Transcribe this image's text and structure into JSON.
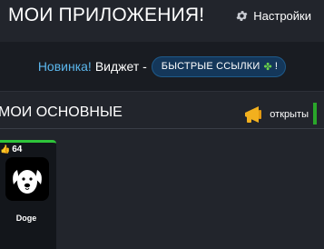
{
  "header": {
    "title": "МОИ ПРИЛОЖЕНИЯ!",
    "settings_label": "Настройки",
    "settings_icon": "gear-icon"
  },
  "promo": {
    "new_label": "Новинка!",
    "widget_label": "Виджет -",
    "pill_label": "БЫСТРЫЕ ССЫЛКИ",
    "pill_icon": "clover-icon",
    "pill_suffix": "!"
  },
  "section": {
    "title": "МОИ ОСНОВНЫЕ",
    "toggle_icon": "megaphone-icon",
    "toggle_label": "открыты",
    "toggle_color": "#2aa62a"
  },
  "apps": [
    {
      "name": "Doge",
      "likes": "64",
      "likes_icon": "thumbs-up-icon",
      "icon": "dog-icon",
      "accent": "#2ec43a"
    }
  ],
  "colors": {
    "background": "#22252c",
    "promo_background": "#191c22",
    "new_label": "#5bb6ec",
    "pill_background": "#14375a"
  }
}
